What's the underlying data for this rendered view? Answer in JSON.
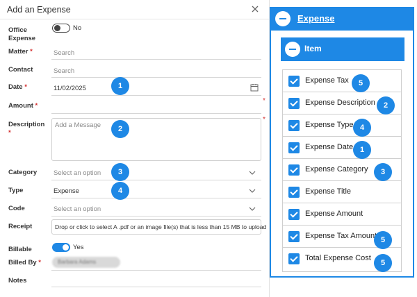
{
  "modal": {
    "title": "Add an Expense",
    "fields": {
      "office_expense": {
        "label": "Office Expense",
        "toggle_on": false,
        "toggle_text": "No"
      },
      "matter": {
        "label": "Matter",
        "required": "*",
        "placeholder": "Search"
      },
      "contact": {
        "label": "Contact",
        "placeholder": "Search"
      },
      "date": {
        "label": "Date",
        "required": "*",
        "value": "11/02/2025"
      },
      "amount": {
        "label": "Amount",
        "required": "*",
        "value": ""
      },
      "description": {
        "label": "Description",
        "required": "*",
        "placeholder": "Add a Message"
      },
      "category": {
        "label": "Category",
        "placeholder": "Select an option"
      },
      "type": {
        "label": "Type",
        "value": "Expense"
      },
      "code": {
        "label": "Code",
        "placeholder": "Select an option"
      },
      "receipt": {
        "label": "Receipt",
        "dropzone_text": "Drop or click to select A .pdf or an image file(s) that is less than 15 MB to upload"
      },
      "billable": {
        "label": "Billable",
        "toggle_on": true,
        "toggle_text": "Yes"
      },
      "billed_by": {
        "label": "Billed By",
        "required": "*",
        "value": "Barbara Adams"
      },
      "notes": {
        "label": "Notes"
      }
    },
    "side_required_mark": "*",
    "badges": [
      "1",
      "2",
      "3",
      "4"
    ]
  },
  "panel": {
    "header": "Expense",
    "item_header": "Item",
    "items": [
      {
        "label": "Expense Tax",
        "checked": true,
        "badge": "5"
      },
      {
        "label": "Expense Description",
        "checked": true,
        "badge": "2"
      },
      {
        "label": "Expense Type",
        "checked": true,
        "badge": "4"
      },
      {
        "label": "Expense Date",
        "checked": true,
        "badge": "1"
      },
      {
        "label": "Expense Category",
        "checked": true,
        "badge": "3"
      },
      {
        "label": "Expense Title",
        "checked": true,
        "badge": ""
      },
      {
        "label": "Expense Amount",
        "checked": true,
        "badge": ""
      },
      {
        "label": "Expense Tax Amount",
        "checked": true,
        "badge": "5"
      },
      {
        "label": "Total Expense Cost",
        "checked": true,
        "badge": "5"
      }
    ]
  },
  "colors": {
    "accent": "#1e88e5",
    "required": "#d32f2f",
    "border": "#d6d6d6"
  },
  "icons": [
    "close-icon",
    "calendar-icon",
    "chevron-down-icon",
    "minus-circle-icon",
    "checkbox-checked-icon"
  ]
}
